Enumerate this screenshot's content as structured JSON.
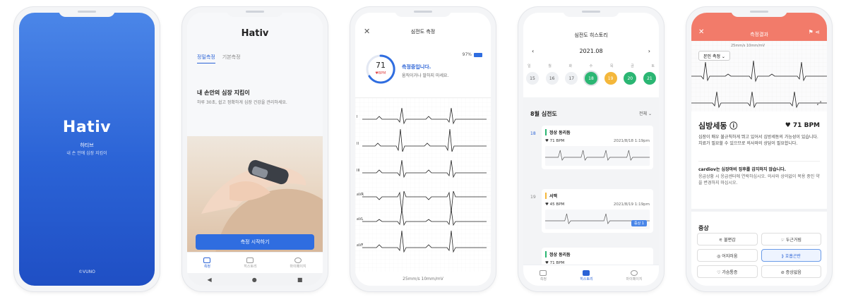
{
  "phone1": {
    "logo": "Hativ",
    "name": "하티브",
    "tagline": "내 손 안에 심장 지킴이",
    "copyright": "©VUNO"
  },
  "phone2": {
    "brand": "Hativ",
    "tabs": [
      "정밀측정",
      "기본측정"
    ],
    "headline": "내 손안의 심장 지킴이",
    "desc": "하루 30초, 쉽고 정확하게 심장 건강을 관리하세요.",
    "start_button": "측정 시작하기",
    "nav": [
      "측정",
      "히스토리",
      "마이페이지"
    ],
    "sys_nav": [
      "◀",
      "●",
      "■"
    ]
  },
  "phone3": {
    "title": "심전도 측정",
    "bpm_value": "71",
    "bpm_unit": "♥BPM",
    "battery": "97%",
    "status": "측정중입니다.",
    "status_sub": "움직이거나 말하지 마세요.",
    "leads": [
      "I",
      "II",
      "III",
      "aVR",
      "aVL",
      "aVF"
    ],
    "footer": "25mm/s  10mm/mV"
  },
  "phone4": {
    "title": "심전도 히스토리",
    "month": "2021.08",
    "weekdays": [
      "일",
      "월",
      "화",
      "수",
      "목",
      "금",
      "토"
    ],
    "days": [
      "15",
      "16",
      "17",
      "18",
      "19",
      "20",
      "21"
    ],
    "section": "8월 심전도",
    "filter": "전체 ⌄",
    "records": [
      {
        "day": "18",
        "label": "정상 동리듬",
        "bpm": "♥ 71 BPM",
        "time": "2021/8/18  1:19pm"
      },
      {
        "day": "19",
        "label": "서맥",
        "bpm": "♥ 45 BPM",
        "time": "2021/8/19  1:19pm",
        "badge": "증상 1"
      },
      {
        "day": "",
        "label": "정상 동리듬",
        "bpm": "♥ 71 BPM",
        "time": ""
      }
    ],
    "nav": [
      "측정",
      "히스토리",
      "마이페이지"
    ]
  },
  "phone5": {
    "title": "측정결과",
    "scale": "25mm/s  10mm/mV",
    "dropdown": "본인 측정 ⌄",
    "diagnosis": "심방세동 ⓘ",
    "bpm": "♥ 71 BPM",
    "desc": "심장이 매우 불규칙하게 뛰고 있어서 심방세동의 가능성이 있습니다. 치료가 필요할 수 있으므로 의사와의 상담이 필요합니다.",
    "note1": "cardiov는 심장마비 징후를 감지하지 않습니다.",
    "note2": "응급상황 시 응급센터에 연락하십시오. 의사와 상의없이 복용 중인 약을 변경하지 마십시오.",
    "symptoms_title": "증상",
    "symptoms": [
      "⚟ 불편감",
      "☞ 두근거림",
      "◎ 어지러움",
      "⟫ 호흡곤란",
      "♡ 가슴통증",
      "⊘ 증상없음"
    ]
  }
}
